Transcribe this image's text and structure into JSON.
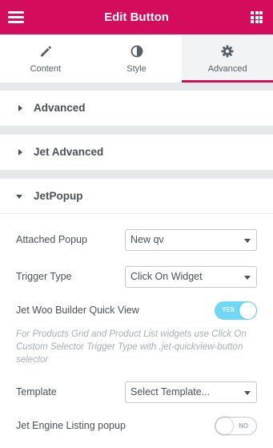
{
  "header": {
    "title": "Edit Button",
    "menu_icon": "hamburger-icon",
    "apps_icon": "grid-icon"
  },
  "tabs": [
    {
      "label": "Content",
      "icon": "pencil-icon",
      "active": false
    },
    {
      "label": "Style",
      "icon": "half-circle-icon",
      "active": false
    },
    {
      "label": "Advanced",
      "icon": "gear-icon",
      "active": true
    }
  ],
  "sections": {
    "advanced": "Advanced",
    "jet_advanced": "Jet Advanced",
    "jetpopup": "JetPopup"
  },
  "controls": {
    "attached_popup": {
      "label": "Attached Popup",
      "value": "New qv"
    },
    "trigger_type": {
      "label": "Trigger Type",
      "value": "Click On Widget"
    },
    "quick_view": {
      "label": "Jet Woo Builder Quick View",
      "state": "YES"
    },
    "description": "For Products Grid and Product List widgets use Click On Custom Selector Trigger Type with .jet-quickview-button selector",
    "template": {
      "label": "Template",
      "value": "Select Template..."
    },
    "listing_popup": {
      "label": "Jet Engine Listing popup",
      "state": "NO"
    }
  },
  "colors": {
    "accent": "#d30c5c",
    "switch_on": "#71d7f7",
    "background_gap": "#e6e9ec"
  }
}
